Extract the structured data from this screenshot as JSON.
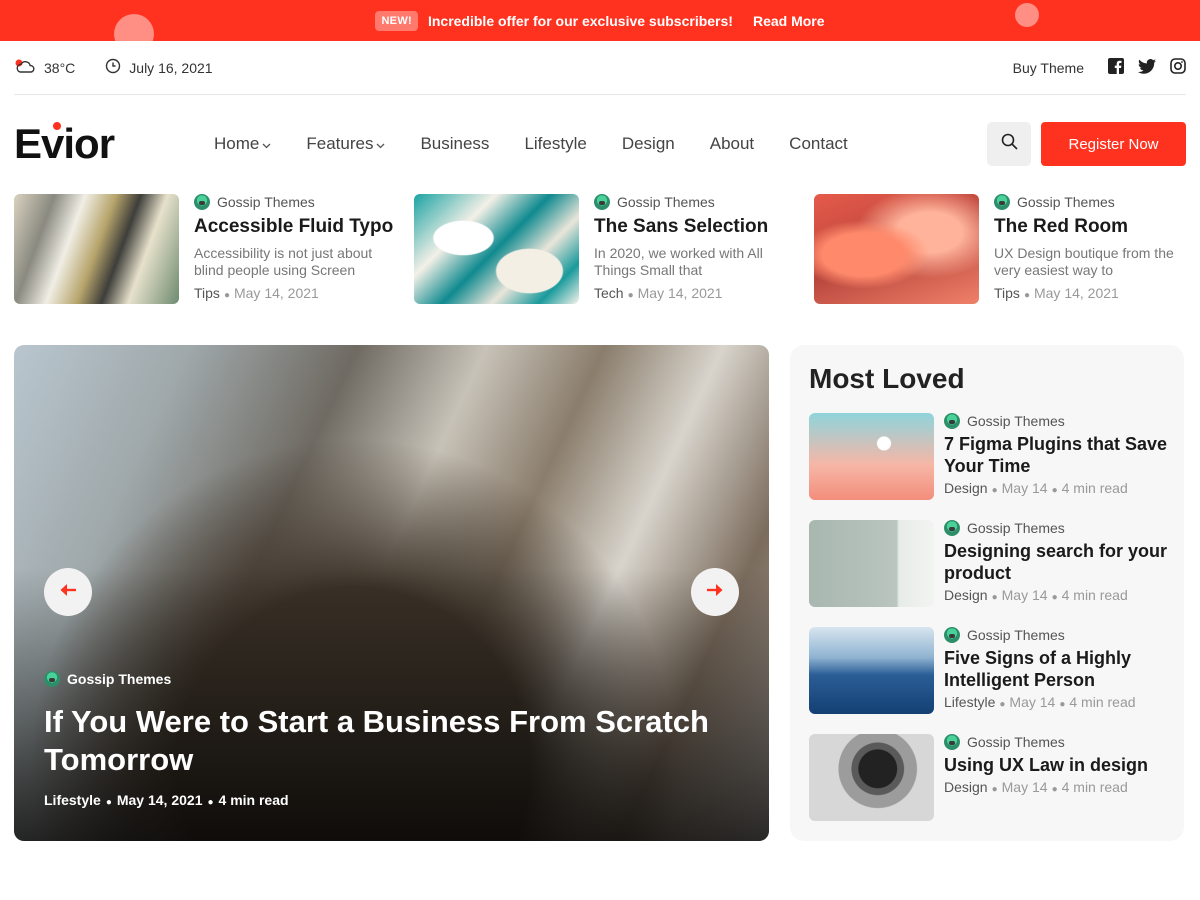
{
  "promo": {
    "badge": "NEW!",
    "text": "Incredible offer for our exclusive subscribers!",
    "link": "Read More"
  },
  "topbar": {
    "temperature": "38°C",
    "date": "July 16, 2021",
    "buy_theme": "Buy Theme",
    "social_icons": [
      "facebook-icon",
      "twitter-icon",
      "instagram-icon"
    ]
  },
  "header": {
    "logo": "Evior",
    "nav": [
      {
        "label": "Home",
        "dropdown": true
      },
      {
        "label": "Features",
        "dropdown": true
      },
      {
        "label": "Business",
        "dropdown": false
      },
      {
        "label": "Lifestyle",
        "dropdown": false
      },
      {
        "label": "Design",
        "dropdown": false
      },
      {
        "label": "About",
        "dropdown": false
      },
      {
        "label": "Contact",
        "dropdown": false
      }
    ],
    "register_label": "Register Now"
  },
  "cards": [
    {
      "author": "Gossip Themes",
      "title": "Accessible Fluid Typo",
      "excerpt": "Accessibility is not just about blind people using Screen",
      "category": "Tips",
      "date": "May 14, 2021"
    },
    {
      "author": "Gossip Themes",
      "title": "The Sans Selection",
      "excerpt": "In 2020, we worked with All Things Small that",
      "category": "Tech",
      "date": "May 14, 2021"
    },
    {
      "author": "Gossip Themes",
      "title": "The Red Room",
      "excerpt": "UX Design boutique from the very easiest way to",
      "category": "Tips",
      "date": "May 14, 2021"
    }
  ],
  "hero": {
    "author": "Gossip Themes",
    "title": "If You Were to Start a Business From Scratch Tomorrow",
    "category": "Lifestyle",
    "date": "May 14, 2021",
    "read_time": "4 min read"
  },
  "sidebar": {
    "title": "Most Loved",
    "items": [
      {
        "author": "Gossip Themes",
        "title": "7 Figma Plugins that Save Your Time",
        "category": "Design",
        "date": "May 14",
        "read_time": "4 min read"
      },
      {
        "author": "Gossip Themes",
        "title": "Designing search for your product",
        "category": "Design",
        "date": "May 14",
        "read_time": "4 min read"
      },
      {
        "author": "Gossip Themes",
        "title": "Five Signs of a Highly Intelligent Person",
        "category": "Lifestyle",
        "date": "May 14",
        "read_time": "4 min read"
      },
      {
        "author": "Gossip Themes",
        "title": "Using UX Law in design",
        "category": "Design",
        "date": "May 14",
        "read_time": "4 min read"
      }
    ]
  },
  "colors": {
    "accent": "#ff3220"
  }
}
